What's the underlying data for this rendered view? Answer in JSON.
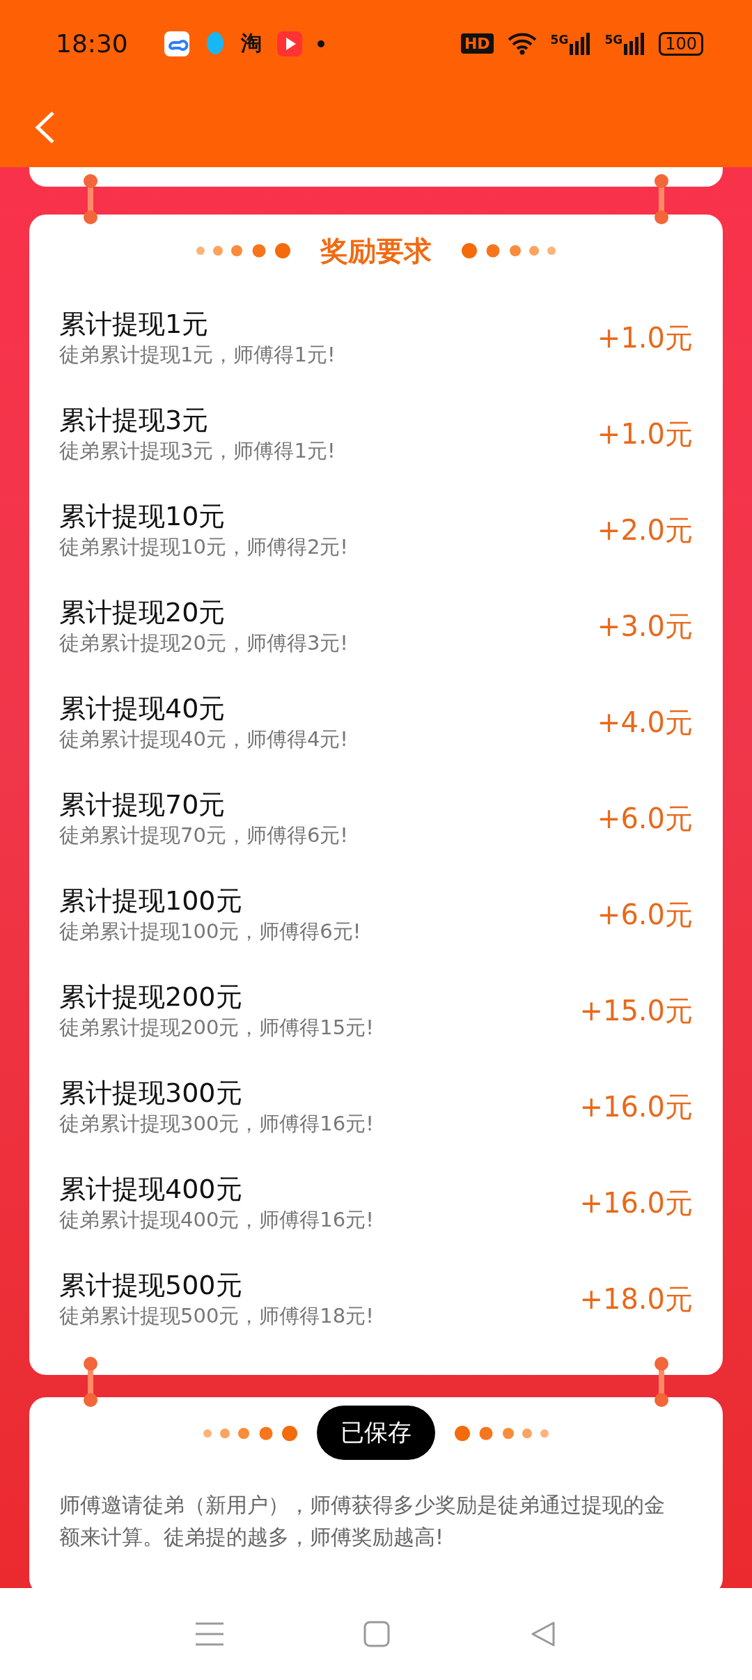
{
  "status_bar": {
    "time": "18:30",
    "taobao_glyph": "淘",
    "hd_badge": "HD",
    "network_1": "5G",
    "network_2": "5G",
    "battery": "100"
  },
  "reward_card": {
    "title": "奖励要求",
    "rows": [
      {
        "title": "累计提现1元",
        "desc": "徒弟累计提现1元，师傅得1元!",
        "amount": "+1.0元"
      },
      {
        "title": "累计提现3元",
        "desc": "徒弟累计提现3元，师傅得1元!",
        "amount": "+1.0元"
      },
      {
        "title": "累计提现10元",
        "desc": "徒弟累计提现10元，师傅得2元!",
        "amount": "+2.0元"
      },
      {
        "title": "累计提现20元",
        "desc": "徒弟累计提现20元，师傅得3元!",
        "amount": "+3.0元"
      },
      {
        "title": "累计提现40元",
        "desc": "徒弟累计提现40元，师傅得4元!",
        "amount": "+4.0元"
      },
      {
        "title": "累计提现70元",
        "desc": "徒弟累计提现70元，师傅得6元!",
        "amount": "+6.0元"
      },
      {
        "title": "累计提现100元",
        "desc": "徒弟累计提现100元，师傅得6元!",
        "amount": "+6.0元"
      },
      {
        "title": "累计提现200元",
        "desc": "徒弟累计提现200元，师傅得15元!",
        "amount": "+15.0元"
      },
      {
        "title": "累计提现300元",
        "desc": "徒弟累计提现300元，师傅得16元!",
        "amount": "+16.0元"
      },
      {
        "title": "累计提现400元",
        "desc": "徒弟累计提现400元，师傅得16元!",
        "amount": "+16.0元"
      },
      {
        "title": "累计提现500元",
        "desc": "徒弟累计提现500元，师傅得18元!",
        "amount": "+18.0元"
      }
    ]
  },
  "notes_card": {
    "text": "师傅邀请徒弟（新用户），师傅获得多少奖励是徒弟通过提现的金额来计算。徒弟提的越多，师傅奖励越高!"
  },
  "toast": {
    "text": "已保存"
  }
}
